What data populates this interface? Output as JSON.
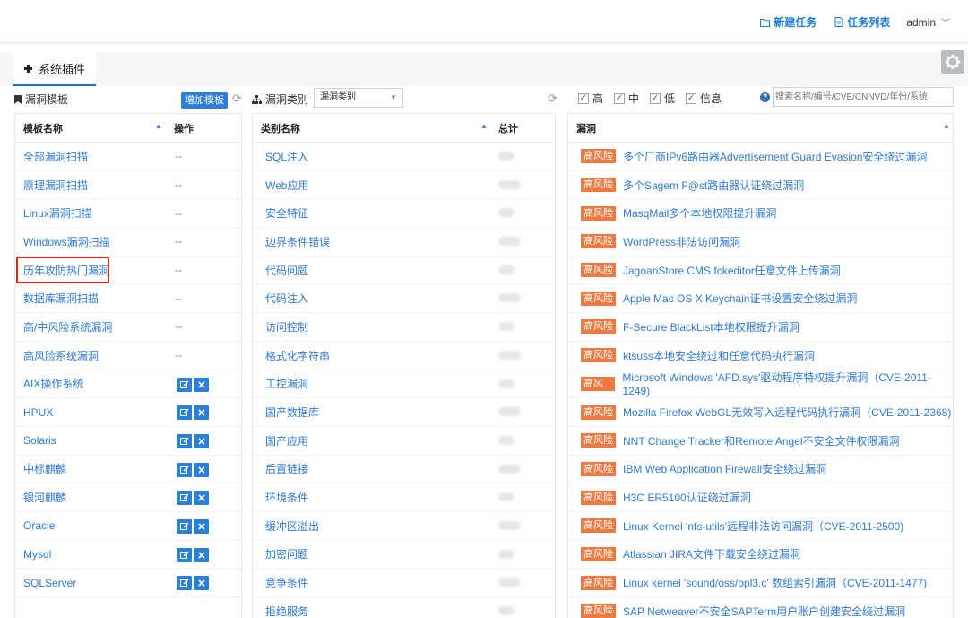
{
  "header": {
    "new_task": "新建任务",
    "task_list": "任务列表",
    "user": "admin"
  },
  "tab": {
    "label": "系统插件"
  },
  "templates": {
    "title": "漏洞模板",
    "add_button": "增加模板",
    "col_name": "模板名称",
    "col_ops": "操作",
    "rows": [
      {
        "name": "全部漏洞扫描",
        "op": "--"
      },
      {
        "name": "原理漏洞扫描",
        "op": "--"
      },
      {
        "name": "Linux漏洞扫描",
        "op": "--"
      },
      {
        "name": "Windows漏洞扫描",
        "op": "--"
      },
      {
        "name": "历年攻防热门漏洞",
        "op": "--"
      },
      {
        "name": "数据库漏洞扫描",
        "op": "--"
      },
      {
        "name": "高/中风险系统漏洞",
        "op": "--"
      },
      {
        "name": "高风险系统漏洞",
        "op": "--"
      },
      {
        "name": "AIX操作系统",
        "op": ""
      },
      {
        "name": "HPUX",
        "op": ""
      },
      {
        "name": "Solaris",
        "op": ""
      },
      {
        "name": "中标麒麟",
        "op": ""
      },
      {
        "name": "银河麒麟",
        "op": ""
      },
      {
        "name": "Oracle",
        "op": ""
      },
      {
        "name": "Mysql",
        "op": ""
      },
      {
        "name": "SQLServer",
        "op": ""
      }
    ]
  },
  "categories": {
    "title": "漏洞类别",
    "select_value": "漏洞类别",
    "col_name": "类别名称",
    "col_total": "总计",
    "rows": [
      {
        "name": "SQL注入"
      },
      {
        "name": "Web应用"
      },
      {
        "name": "安全特征"
      },
      {
        "name": "边界条件错误"
      },
      {
        "name": "代码问题"
      },
      {
        "name": "代码注入"
      },
      {
        "name": "访问控制"
      },
      {
        "name": "格式化字符串"
      },
      {
        "name": "工控漏洞"
      },
      {
        "name": "国产数据库"
      },
      {
        "name": "国产应用"
      },
      {
        "name": "后置链接"
      },
      {
        "name": "环境条件"
      },
      {
        "name": "缓冲区溢出"
      },
      {
        "name": "加密问题"
      },
      {
        "name": "竞争条件"
      },
      {
        "name": "拒绝服务"
      }
    ]
  },
  "filters": {
    "high": "高",
    "medium": "中",
    "low": "低",
    "info": "信息",
    "search_placeholder": "搜索名称/编号/CVE/CNNVD/年份/系统"
  },
  "vulns": {
    "col_name": "漏洞",
    "badge": "高风险",
    "rows": [
      {
        "name": "多个厂商IPv6路由器Advertisement Guard Evasion安全绕过漏洞"
      },
      {
        "name": "多个Sagem F@st路由器认证绕过漏洞"
      },
      {
        "name": "MasqMail多个本地权限提升漏洞"
      },
      {
        "name": "WordPress非法访问漏洞"
      },
      {
        "name": "JagoanStore CMS fckeditor任意文件上传漏洞"
      },
      {
        "name": "Apple Mac OS X Keychain证书设置安全绕过漏洞"
      },
      {
        "name": "F-Secure BlackList本地权限提升漏洞"
      },
      {
        "name": "ktsuss本地安全绕过和任意代码执行漏洞"
      },
      {
        "name": "Microsoft Windows 'AFD.sys'驱动程序特权提升漏洞（CVE-2011-1249)"
      },
      {
        "name": "Mozilla Firefox WebGL无效写入远程代码执行漏洞（CVE-2011-2368)"
      },
      {
        "name": "NNT Change Tracker和Remote Angel不安全文件权限漏洞"
      },
      {
        "name": "IBM Web Application Firewall安全绕过漏洞"
      },
      {
        "name": "H3C ER5100认证绕过漏洞"
      },
      {
        "name": "Linux Kernel 'nfs-utils'远程非法访问漏洞（CVE-2011-2500)"
      },
      {
        "name": "Atlassian JIRA文件下载安全绕过漏洞"
      },
      {
        "name": "Linux kernel 'sound/oss/opl3.c' 数组索引漏洞（CVE-2011-1477)"
      },
      {
        "name": "SAP Netweaver不安全SAPTerm用户账户创建安全绕过漏洞"
      }
    ]
  },
  "colors": {
    "accent": "#2b7fd9",
    "badge": "#ee7a42",
    "highlight": "#e0241e"
  }
}
